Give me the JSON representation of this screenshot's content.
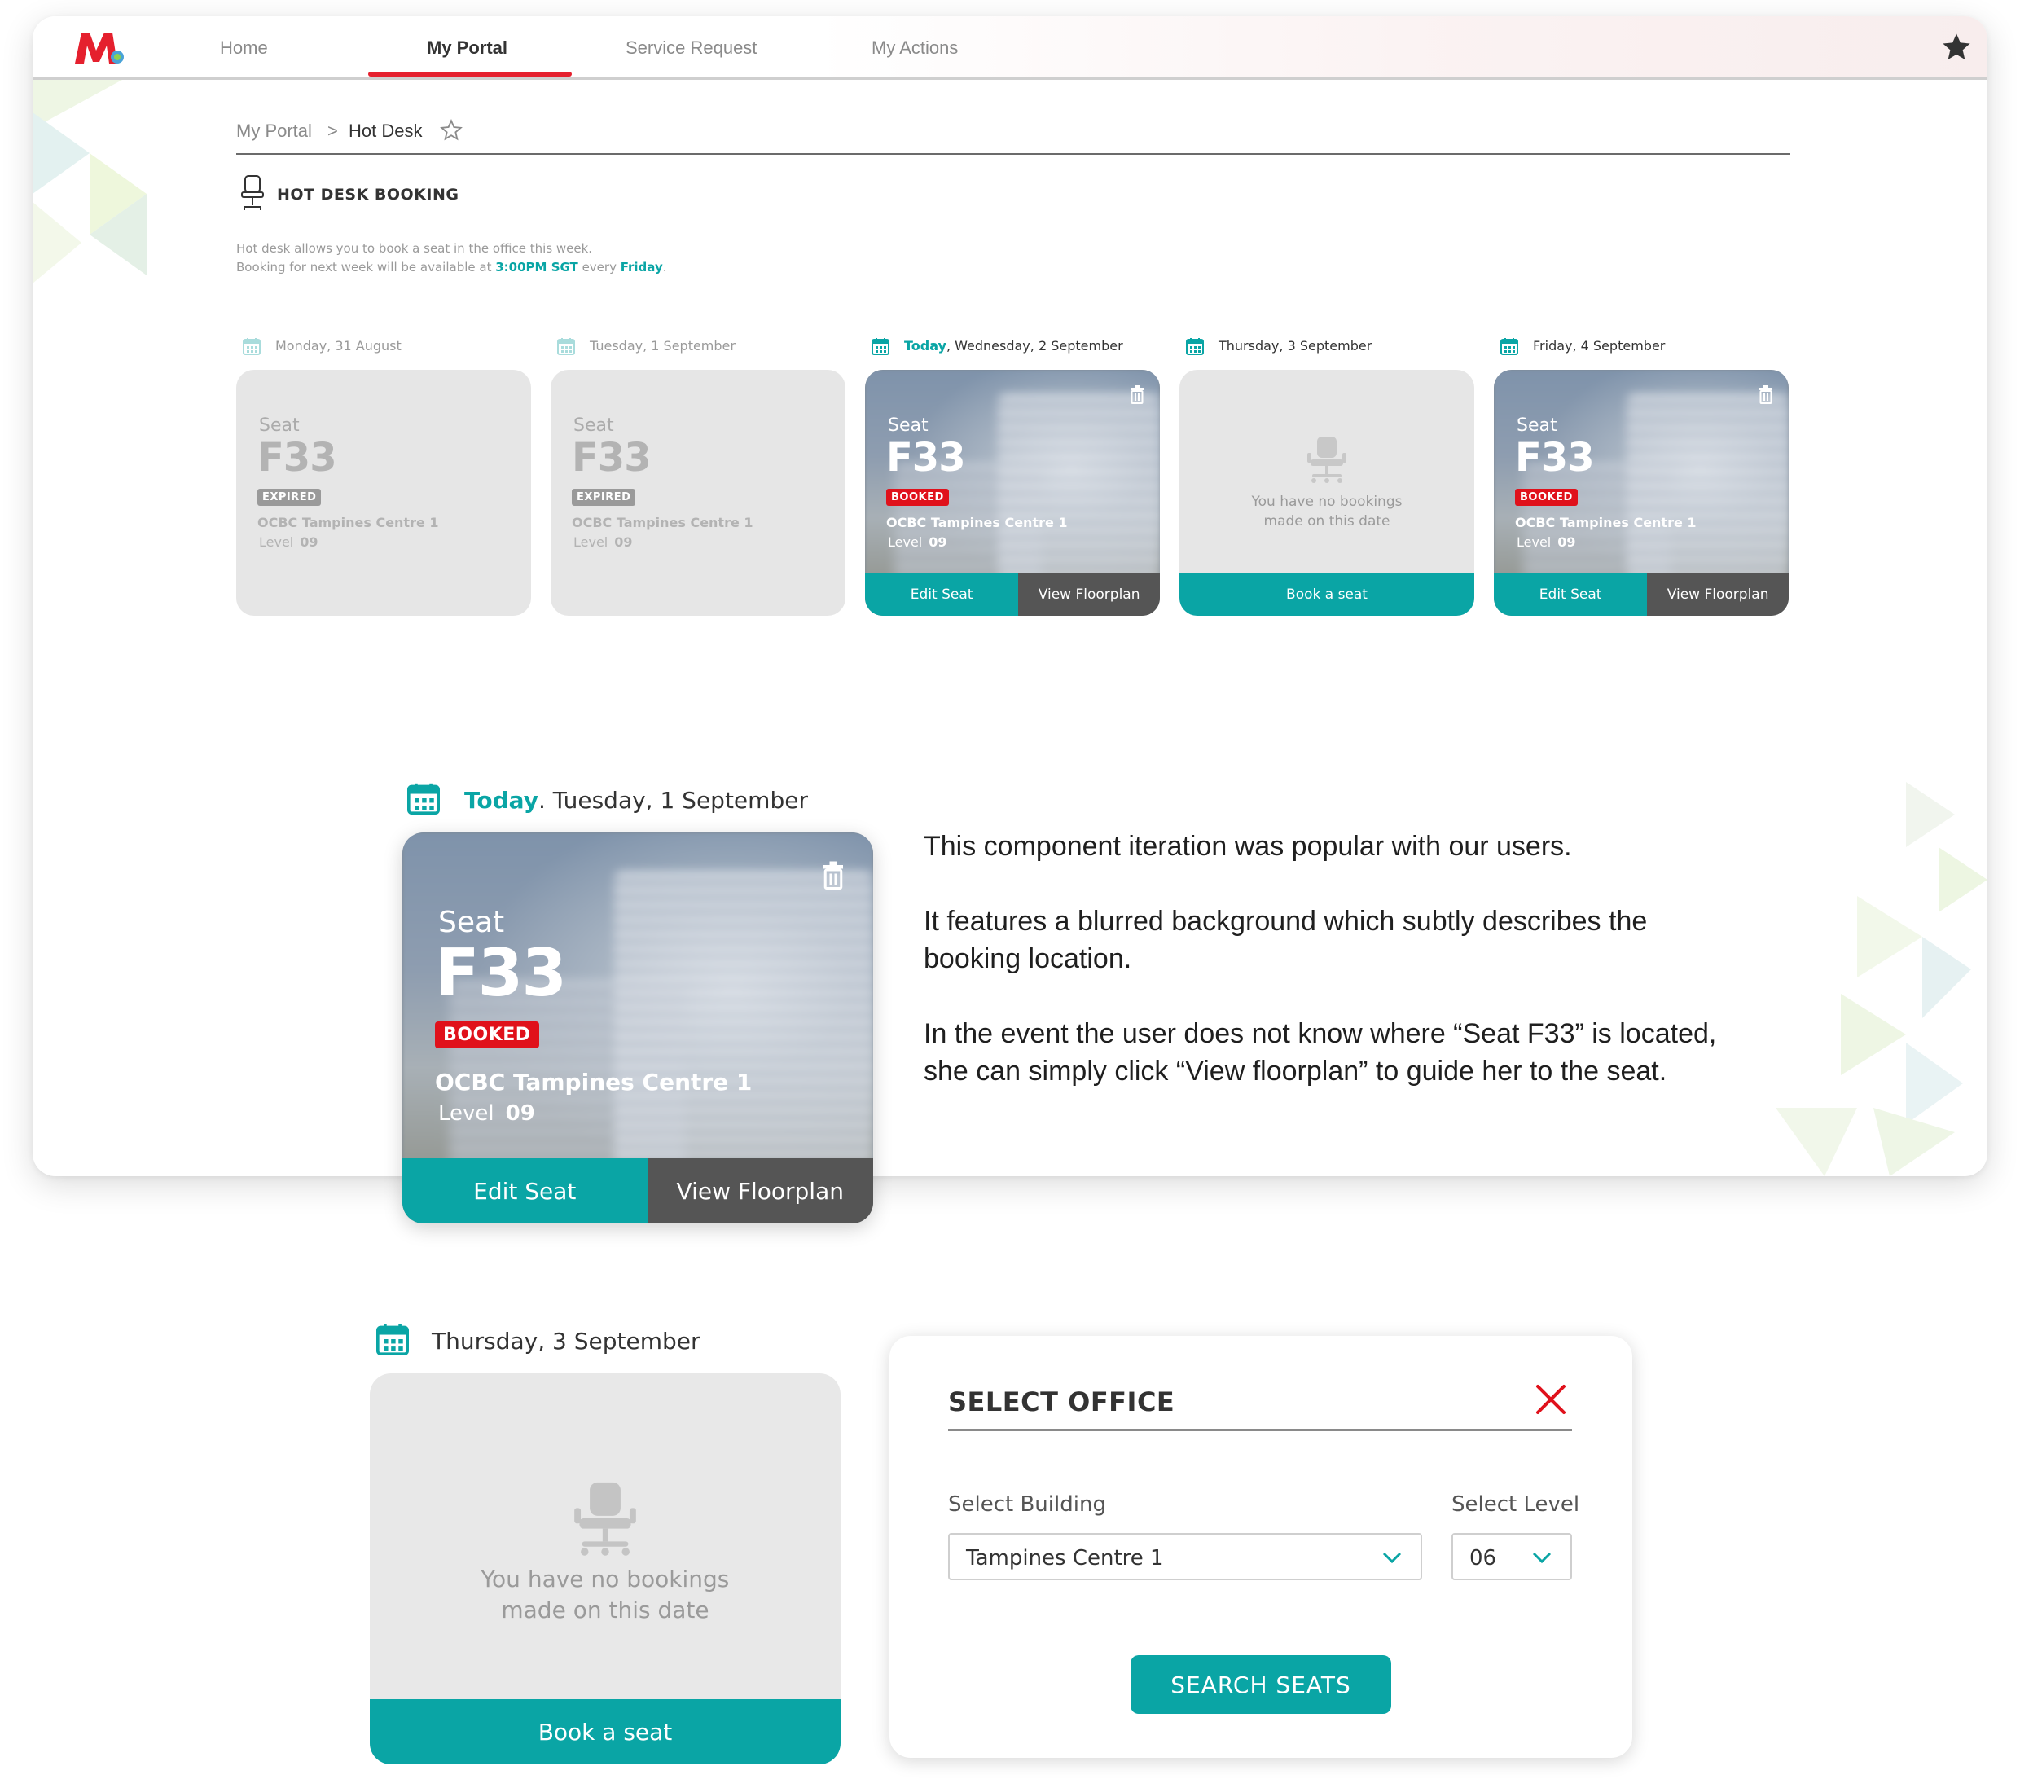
{
  "colors": {
    "teal": "#0aa5a5",
    "red": "#e0111b",
    "dark_button": "#555555",
    "accent_nav": "#e5202e"
  },
  "nav": {
    "items": [
      {
        "label": "Home"
      },
      {
        "label": "My Portal"
      },
      {
        "label": "Service Request"
      },
      {
        "label": "My Actions"
      }
    ],
    "active": "My Portal"
  },
  "breadcrumb": {
    "root": "My Portal",
    "separator": ">",
    "current": "Hot Desk"
  },
  "section": {
    "title": "HOT DESK BOOKING",
    "intro_line1": "Hot desk allows you to book a seat in the office this week.",
    "intro_line2_a": "Booking for next week will be available at ",
    "intro_time": "3:00PM SGT",
    "intro_line2_b": " every ",
    "intro_day": "Friday",
    "intro_end": "."
  },
  "week": [
    {
      "date": "Monday, 31 August",
      "seat_label": "Seat",
      "seat": "F33",
      "status": "EXPIRED",
      "building": "OCBC Tampines Centre 1",
      "level_label": "Level",
      "level": "09"
    },
    {
      "date": "Tuesday, 1 September",
      "seat_label": "Seat",
      "seat": "F33",
      "status": "EXPIRED",
      "building": "OCBC Tampines Centre 1",
      "level_label": "Level",
      "level": "09"
    },
    {
      "today": "Today",
      "date": ", Wednesday, 2 September",
      "seat_label": "Seat",
      "seat": "F33",
      "status": "BOOKED",
      "building": "OCBC Tampines Centre 1",
      "level_label": "Level",
      "level": "09",
      "edit": "Edit Seat",
      "floorplan": "View Floorplan"
    },
    {
      "date": "Thursday, 3 September",
      "empty_line1": "You have no bookings",
      "empty_line2": "made on this date",
      "book": "Book a seat"
    },
    {
      "date": "Friday, 4 September",
      "seat_label": "Seat",
      "seat": "F33",
      "status": "BOOKED",
      "building": "OCBC Tampines Centre 1",
      "level_label": "Level",
      "level": "09",
      "edit": "Edit Seat",
      "floorplan": "View Floorplan"
    }
  ],
  "featured": {
    "today": "Today",
    "date": ". Tuesday, 1 September",
    "seat_label": "Seat",
    "seat": "F33",
    "status": "BOOKED",
    "building": "OCBC Tampines Centre 1",
    "level_label": "Level",
    "level": "09",
    "edit": "Edit Seat",
    "floorplan": "View Floorplan"
  },
  "description": {
    "p1": "This component iteration was popular with our users.",
    "p2": "It features a blurred background which subtly describes the booking location.",
    "p3": "In the event the user does not know where “Seat F33” is located, she can simply click “View floorplan” to guide her to the seat."
  },
  "empty_card": {
    "date": "Thursday, 3 September",
    "line1": "You have no bookings",
    "line2": "made on this date",
    "book": "Book a seat"
  },
  "modal": {
    "title": "SELECT OFFICE",
    "building_label": "Select Building",
    "building_value": "Tampines Centre 1",
    "level_label": "Select Level",
    "level_value": "06",
    "search": "SEARCH SEATS"
  }
}
